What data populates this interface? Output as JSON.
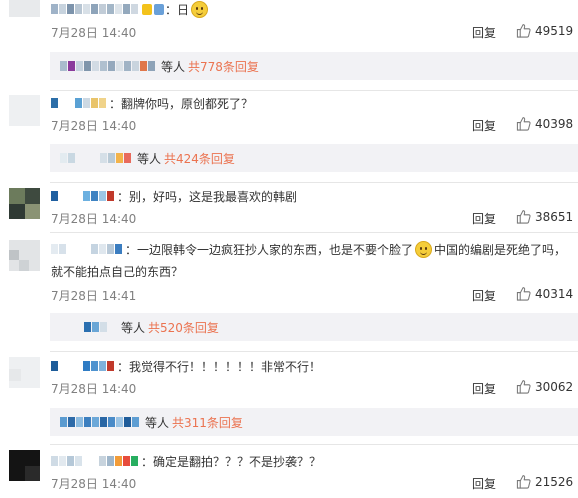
{
  "comments": [
    {
      "text": "：日",
      "time": "7月28日 14:40",
      "reply": "回复",
      "likes": "49519",
      "sub": {
        "who": "等人",
        "count": "共778条回复"
      }
    },
    {
      "text": "：翻牌你吗，原创都死了？",
      "time": "7月28日 14:40",
      "reply": "回复",
      "likes": "40398",
      "sub": {
        "who": "等人",
        "count": "共424条回复"
      }
    },
    {
      "text": "：别，好吗，这是我最喜欢的韩剧",
      "time": "7月28日 14:40",
      "reply": "回复",
      "likes": "38651"
    },
    {
      "text_a": "：一边限韩令一边疯狂抄人家的东西，也是不要个脸了",
      "text_b": "中国的编剧是死绝了吗，",
      "text_c": "就不能拍点自己的东西？",
      "time": "7月28日 14:41",
      "reply": "回复",
      "likes": "40314",
      "sub": {
        "who": "等人",
        "count": "共520条回复"
      }
    },
    {
      "text": "：我觉得不行！！！！！！非常不行！",
      "time": "7月28日 14:40",
      "reply": "回复",
      "likes": "30062",
      "sub": {
        "who": "等人",
        "count": "共311条回复"
      }
    },
    {
      "text": "：确定是翻拍？？？不是抄袭？？",
      "time": "7月28日 14:40",
      "reply": "回复",
      "likes": "21526"
    }
  ],
  "icons": {
    "like": "thumbs-up-icon",
    "emoji": "smiley-emoji-icon"
  },
  "colors": {
    "accent": "#eb7350",
    "muted": "#808080",
    "subbg": "#f2f2f5"
  }
}
